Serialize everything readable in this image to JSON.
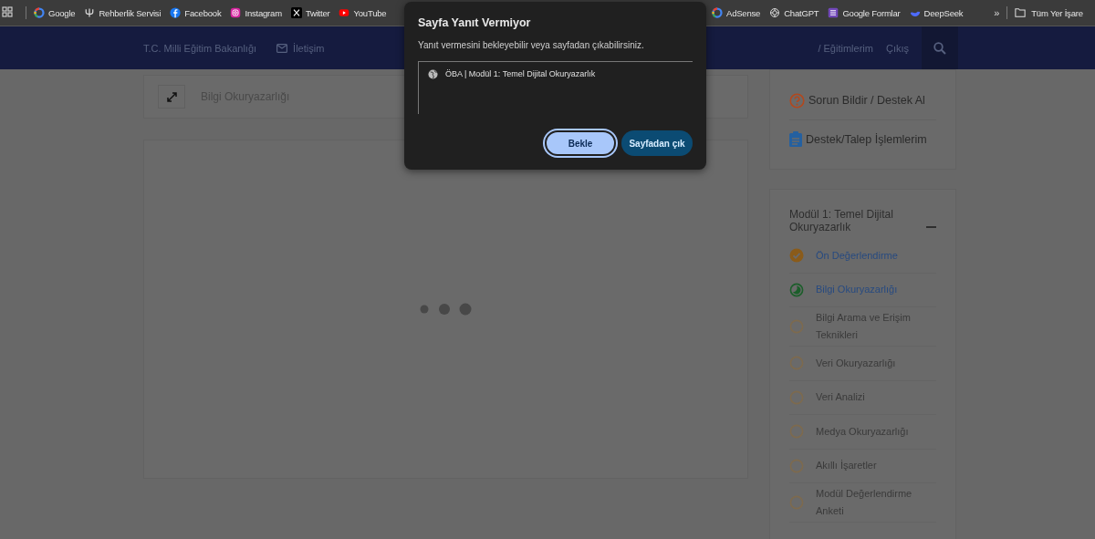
{
  "bookmarks_bar": {
    "left": [
      {
        "kind": "google",
        "label": "Google"
      },
      {
        "kind": "psi",
        "label": "Rehberlik Servisi"
      },
      {
        "kind": "facebook",
        "label": "Facebook"
      },
      {
        "kind": "instagram",
        "label": "Instagram"
      },
      {
        "kind": "x",
        "label": "Twitter"
      },
      {
        "kind": "youtube",
        "label": "YouTube"
      }
    ],
    "right": [
      {
        "kind": "google",
        "label": "AdSense"
      },
      {
        "kind": "chatgpt",
        "label": "ChatGPT"
      },
      {
        "kind": "forms",
        "label": "Google Formlar"
      },
      {
        "kind": "whale",
        "label": "DeepSeek"
      }
    ],
    "overflow": "»",
    "all_bookmarks": "Tüm Yer İşare"
  },
  "header": {
    "brand": "T.C. Milli Eğitim Bakanlığı",
    "contact": "İletişim",
    "my_trainings": "/ Eğitimlerim",
    "logout": "Çıkış"
  },
  "lesson_bar": {
    "title": "Bilgi Okuryazarlığı"
  },
  "support": [
    {
      "kind": "question",
      "label": "Sorun Bildir / Destek Al"
    },
    {
      "kind": "clipboard",
      "label": "Destek/Talep İşlemlerim"
    }
  ],
  "module": {
    "title": "Modül 1: Temel Dijital Okuryazarlık",
    "expanded": true,
    "lessons": [
      {
        "label": "Ön Değerlendirme",
        "kind": "done"
      },
      {
        "label": "Bilgi Okuryazarlığı",
        "kind": "current"
      },
      {
        "label": "Bilgi Arama ve Erişim Teknikleri",
        "kind": "pending"
      },
      {
        "label": "Veri Okuryazarlığı",
        "kind": "pending"
      },
      {
        "label": "Veri Analizi",
        "kind": "pending"
      },
      {
        "label": "Medya Okuryazarlığı",
        "kind": "pending"
      },
      {
        "label": "Akıllı İşaretler",
        "kind": "pending"
      },
      {
        "label": "Modül Değerlendirme Anketi",
        "kind": "pending"
      }
    ]
  },
  "dialog": {
    "title": "Sayfa Yanıt Vermiyor",
    "message": "Yanıt vermesini bekleyebilir veya sayfadan çıkabilirsiniz.",
    "page": "ÖBA | Modül 1: Temel Dijital Okuryazarlık",
    "buttons": [
      {
        "label": "Bekle",
        "kind": "primary"
      },
      {
        "label": "Sayfadan çık",
        "kind": "secondary"
      }
    ]
  }
}
